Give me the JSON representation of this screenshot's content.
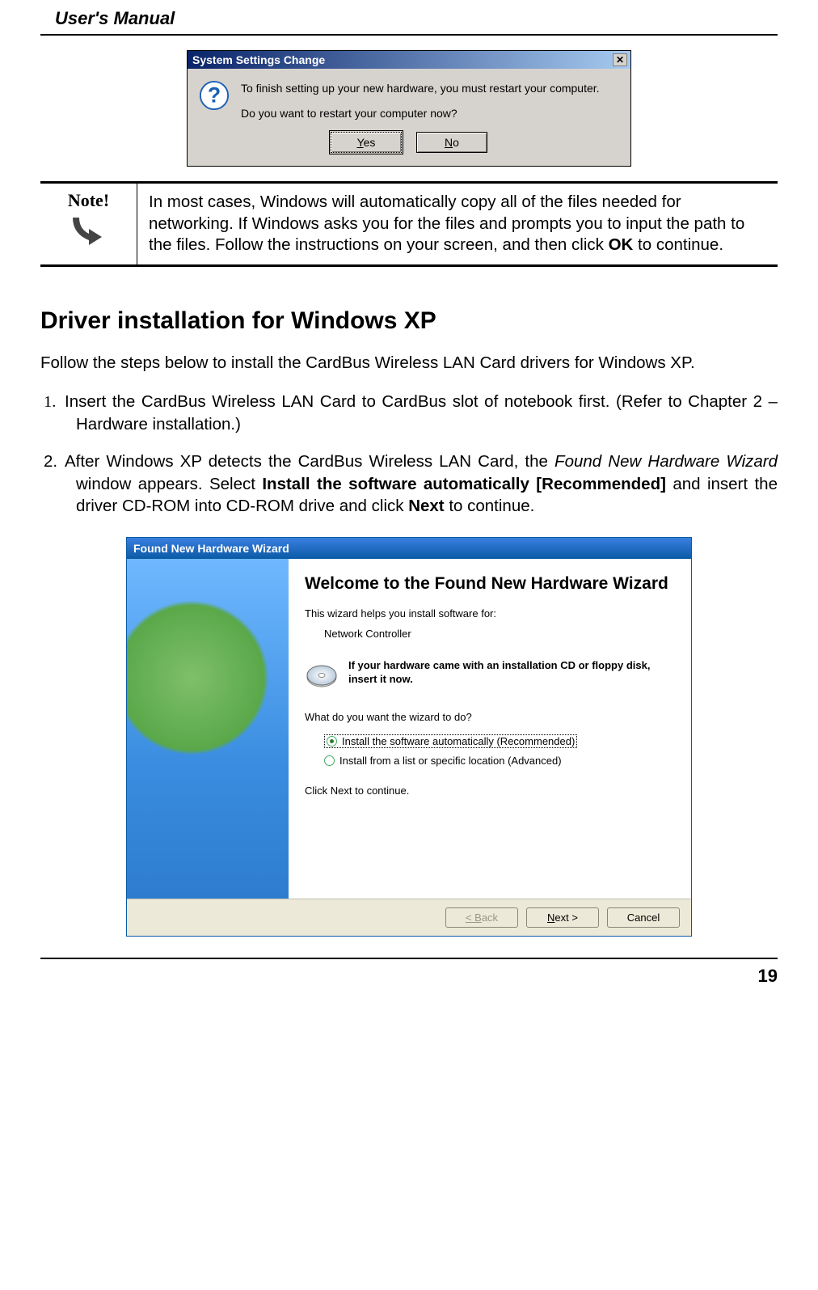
{
  "header": {
    "title": "User's Manual"
  },
  "dialog1": {
    "title": "System Settings Change",
    "line1": "To finish setting up your new hardware, you must restart your computer.",
    "line2": "Do you want to restart your computer now?",
    "yes_label": "Yes",
    "no_label": "No"
  },
  "note": {
    "label": "Note!",
    "text_before_ok": "In most cases, Windows will automatically copy all of the files needed for networking. If Windows asks you for the files and prompts you to input the path to the files. Follow the instructions on your screen, and then click ",
    "ok_word": "OK",
    "text_after_ok": " to continue."
  },
  "section": {
    "title": "Driver installation for Windows XP",
    "intro": "Follow the steps below to install the CardBus Wireless LAN Card drivers for Windows XP.",
    "steps": {
      "s1": "Insert the CardBus Wireless LAN Card to CardBus slot of notebook first. (Refer to Chapter 2 – Hardware installation.)",
      "s2_a": "After Windows XP detects the CardBus Wireless LAN Card, the ",
      "s2_i": "Found New Hardware Wizard",
      "s2_b": " window appears.  Select ",
      "s2_bold1": "Install the software automatically [Recommended]",
      "s2_c": " and insert the driver CD-ROM into CD-ROM drive and click ",
      "s2_bold2": "Next",
      "s2_d": " to continue."
    }
  },
  "dialog2": {
    "title": "Found New Hardware Wizard",
    "heading": "Welcome to the Found New Hardware Wizard",
    "help_text": "This wizard helps you install software for:",
    "device": "Network Controller",
    "cd_text": "If your hardware came with an installation CD or floppy disk, insert it now.",
    "prompt": "What do you want the wizard to do?",
    "opt1": "Install the software automatically (Recommended)",
    "opt2": "Install from a list or specific location (Advanced)",
    "continue_hint": "Click Next to continue.",
    "back_label": "< Back",
    "next_label": "Next >",
    "cancel_label": "Cancel"
  },
  "footer": {
    "page_number": "19"
  }
}
